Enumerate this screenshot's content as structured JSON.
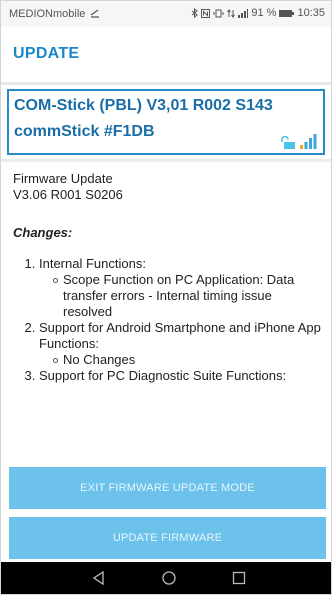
{
  "statusbar": {
    "carrier": "MEDIONmobile",
    "battery_percent": "91 %",
    "time": "10:35"
  },
  "appbar": {
    "title": "UPDATE"
  },
  "device": {
    "name_line1": "COM-Stick (PBL) V3,01 R002 S143",
    "name_line2": "commStick #F1DB",
    "icons": [
      "unlocked-lock-icon",
      "signal-bars-icon"
    ]
  },
  "firmware": {
    "label": "Firmware Update",
    "version": "V3.06 R001 S0206",
    "changes_heading": "Changes:",
    "items": [
      {
        "text": "Internal Functions:",
        "sub": [
          "Scope Function on PC Application: Data transfer errors - Internal timing issue resolved"
        ]
      },
      {
        "text": "Support for Android Smartphone and iPhone App Functions:",
        "sub": [
          "No Changes"
        ]
      },
      {
        "text": "Support for PC Diagnostic Suite Functions:",
        "sub": []
      }
    ]
  },
  "buttons": {
    "exit_label": "EXIT FIRMWARE UPDATE MODE",
    "update_label": "UPDATE FIRMWARE"
  },
  "colors": {
    "accent": "#1a87c6",
    "button": "#6cc2ea",
    "navbar": "#000000"
  }
}
